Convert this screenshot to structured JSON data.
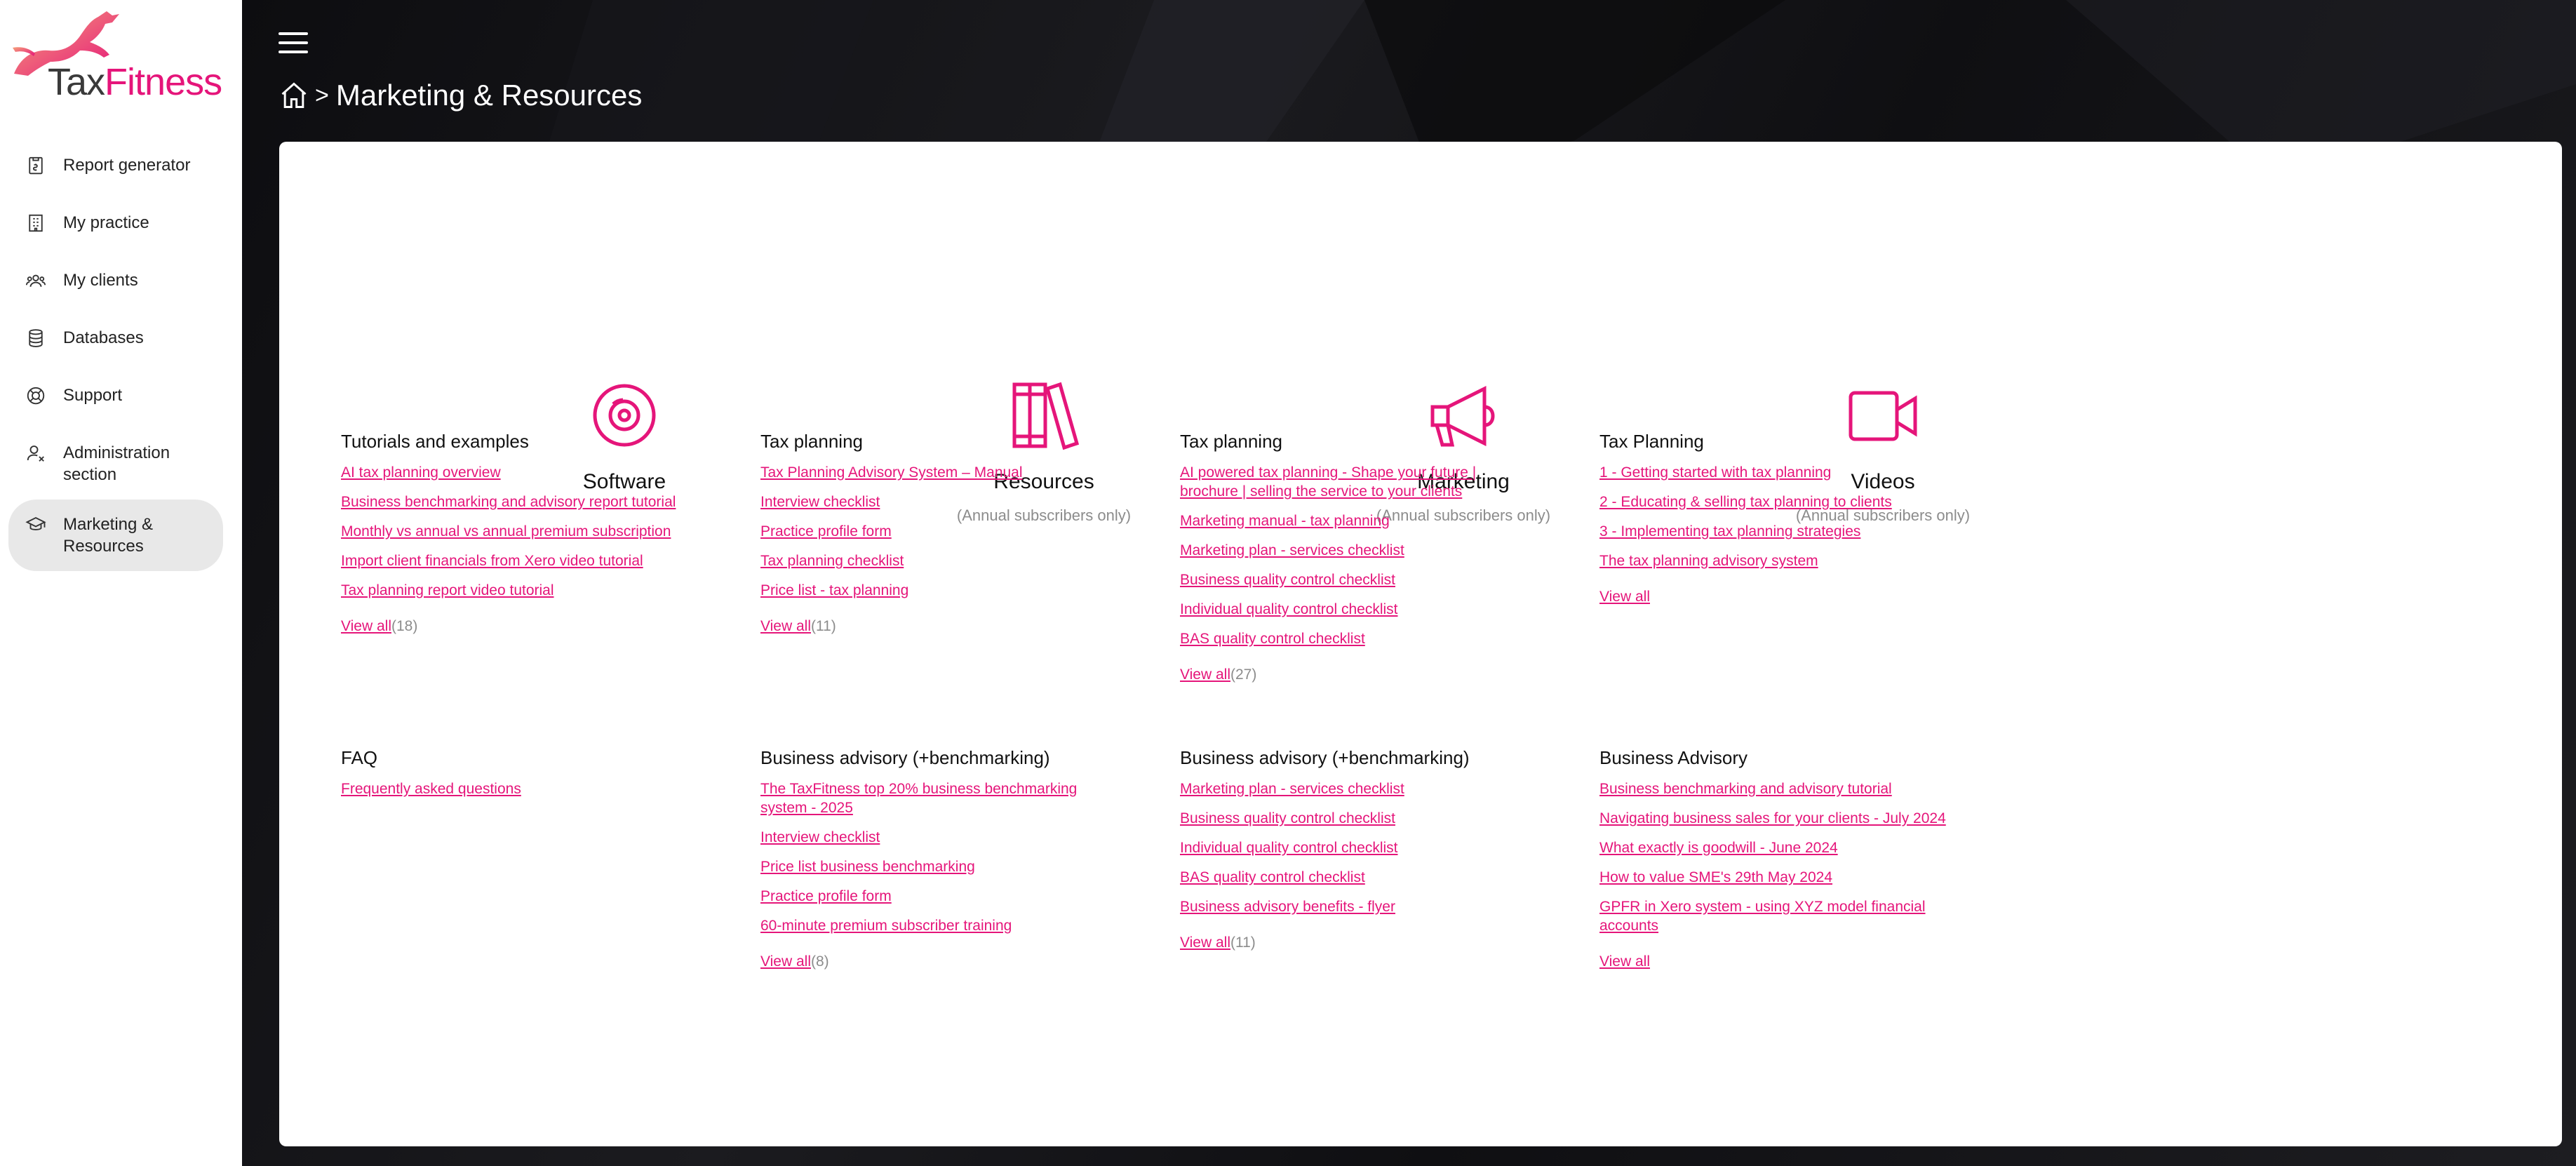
{
  "app": {
    "logo_tax": "Tax",
    "logo_fitness": "Fitness"
  },
  "colors": {
    "accent": "#e5157a",
    "sidebar_active": "#e8e8e8",
    "header_bg": "#141417"
  },
  "sidebar": {
    "items": [
      {
        "label": "Report generator",
        "icon": "report-icon"
      },
      {
        "label": "My practice",
        "icon": "building-icon"
      },
      {
        "label": "My clients",
        "icon": "users-icon"
      },
      {
        "label": "Databases",
        "icon": "database-icon"
      },
      {
        "label": "Support",
        "icon": "lifebuoy-icon"
      },
      {
        "label": "Administration section",
        "icon": "user-admin-icon"
      },
      {
        "label": "Marketing & Resources",
        "icon": "graduation-cap-icon",
        "active": true
      }
    ]
  },
  "header": {
    "breadcrumb_title": "Marketing & Resources",
    "separator": ">"
  },
  "categories": [
    {
      "name": "Software",
      "subtitle": "",
      "icon": "disc-icon"
    },
    {
      "name": "Resources",
      "subtitle": "(Annual subscribers only)",
      "icon": "books-icon"
    },
    {
      "name": "Marketing",
      "subtitle": "(Annual subscribers only)",
      "icon": "megaphone-icon"
    },
    {
      "name": "Videos",
      "subtitle": "(Annual subscribers only)",
      "icon": "video-camera-icon"
    }
  ],
  "groups": {
    "software_tutorials": {
      "title": "Tutorials and examples",
      "links": [
        "AI tax planning overview",
        "Business benchmarking and advisory report tutorial",
        "Monthly vs annual vs annual premium subscription",
        "Import client financials from Xero video tutorial",
        "Tax planning report video tutorial"
      ],
      "view_all": "View all",
      "count": "(18)"
    },
    "resources_tax": {
      "title": "Tax planning",
      "links": [
        "Tax Planning Advisory System – Manual",
        "Interview checklist",
        "Practice profile form",
        "Tax planning checklist",
        "Price list - tax planning"
      ],
      "view_all": "View all",
      "count": "(11)"
    },
    "marketing_tax": {
      "title": "Tax planning",
      "links": [
        "AI powered tax planning - Shape your future | brochure | selling the service to your clients",
        "Marketing manual - tax planning",
        "Marketing plan - services checklist",
        "Business quality control checklist",
        "Individual quality control checklist",
        "BAS quality control checklist"
      ],
      "view_all": "View all",
      "count": "(27)"
    },
    "videos_tax": {
      "title": "Tax Planning",
      "links": [
        "1 -  Getting started with tax planning",
        "2 - Educating & selling tax planning to clients",
        "3 - Implementing tax planning strategies",
        "The tax planning advisory system"
      ],
      "view_all": "View all",
      "count": ""
    },
    "software_faq": {
      "title": "FAQ",
      "links": [
        "Frequently asked questions"
      ],
      "view_all": "",
      "count": ""
    },
    "resources_business": {
      "title": "Business advisory (+benchmarking)",
      "links": [
        "The TaxFitness top 20% business benchmarking system - 2025",
        "Interview checklist",
        "Price list business benchmarking",
        "Practice profile form",
        "60-minute premium subscriber training"
      ],
      "view_all": "View all",
      "count": "(8)"
    },
    "marketing_business": {
      "title": "Business advisory (+benchmarking)",
      "links": [
        "Marketing plan - services checklist",
        "Business quality control checklist",
        "Individual quality control checklist",
        "BAS quality control checklist",
        "Business advisory benefits - flyer"
      ],
      "view_all": "View all",
      "count": "(11)"
    },
    "videos_business": {
      "title": "Business Advisory",
      "links": [
        "Business benchmarking and advisory tutorial",
        "Navigating business sales for your clients - July 2024",
        "What exactly is goodwill - June 2024",
        "How to value SME's 29th May 2024",
        "GPFR in Xero system - using XYZ model financial accounts"
      ],
      "view_all": "View all",
      "count": ""
    }
  }
}
